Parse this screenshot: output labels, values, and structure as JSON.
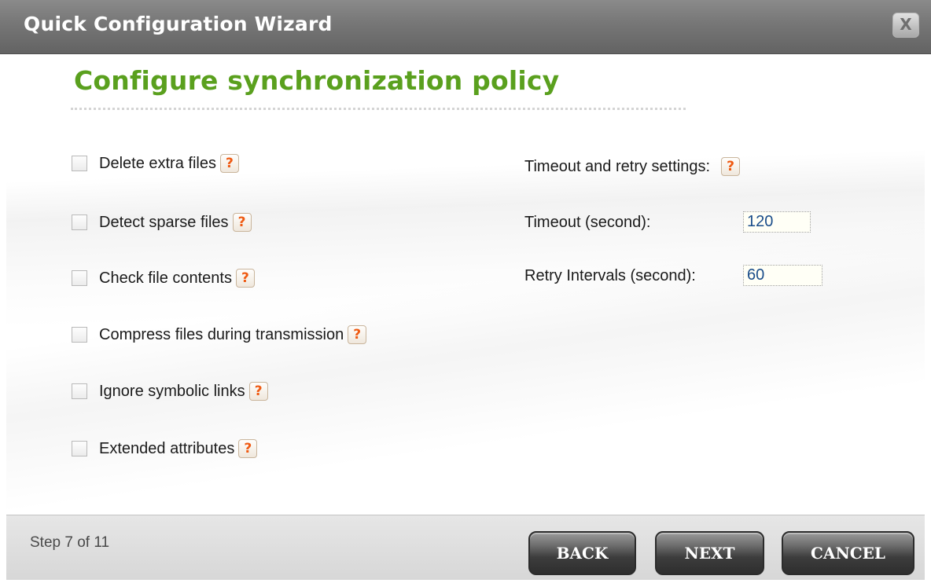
{
  "window": {
    "title": "Quick Configuration Wizard",
    "close_label": "X"
  },
  "page": {
    "title": "Configure synchronization policy"
  },
  "options": [
    {
      "label": "Delete extra files",
      "checked": false
    },
    {
      "label": "Detect sparse files",
      "checked": false
    },
    {
      "label": "Check file contents",
      "checked": false
    },
    {
      "label": "Compress files during transmission",
      "checked": false
    },
    {
      "label": "Ignore symbolic links",
      "checked": false
    },
    {
      "label": "Extended attributes",
      "checked": false
    }
  ],
  "timeout_settings": {
    "heading": "Timeout and retry settings:",
    "timeout_label": "Timeout (second):",
    "timeout_value": "120",
    "retry_label": "Retry Intervals (second):",
    "retry_value": "60"
  },
  "help_icon_glyph": "?",
  "footer": {
    "step_text": "Step 7 of 11",
    "back_label": "BACK",
    "next_label": "NEXT",
    "cancel_label": "CANCEL"
  },
  "colors": {
    "title_green": "#5aa01e",
    "help_orange": "#ef5a12",
    "titlebar_gray": "#767676",
    "button_dark": "#2e2e2e"
  }
}
